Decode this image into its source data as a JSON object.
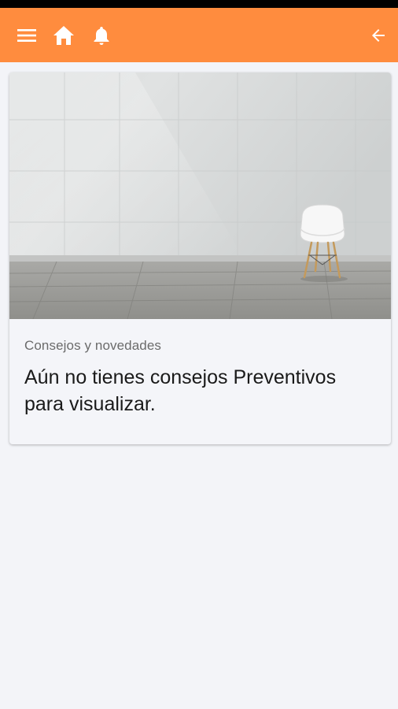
{
  "toolbar": {
    "background_color": "#ff8c3e",
    "icons": [
      "menu-icon",
      "home-icon",
      "bell-icon",
      "arrow-back-icon"
    ]
  },
  "card": {
    "image": "empty-room-with-white-chair",
    "subtitle": "Consejos y novedades",
    "title": "Aún no tienes consejos Preventivos para visualizar."
  }
}
